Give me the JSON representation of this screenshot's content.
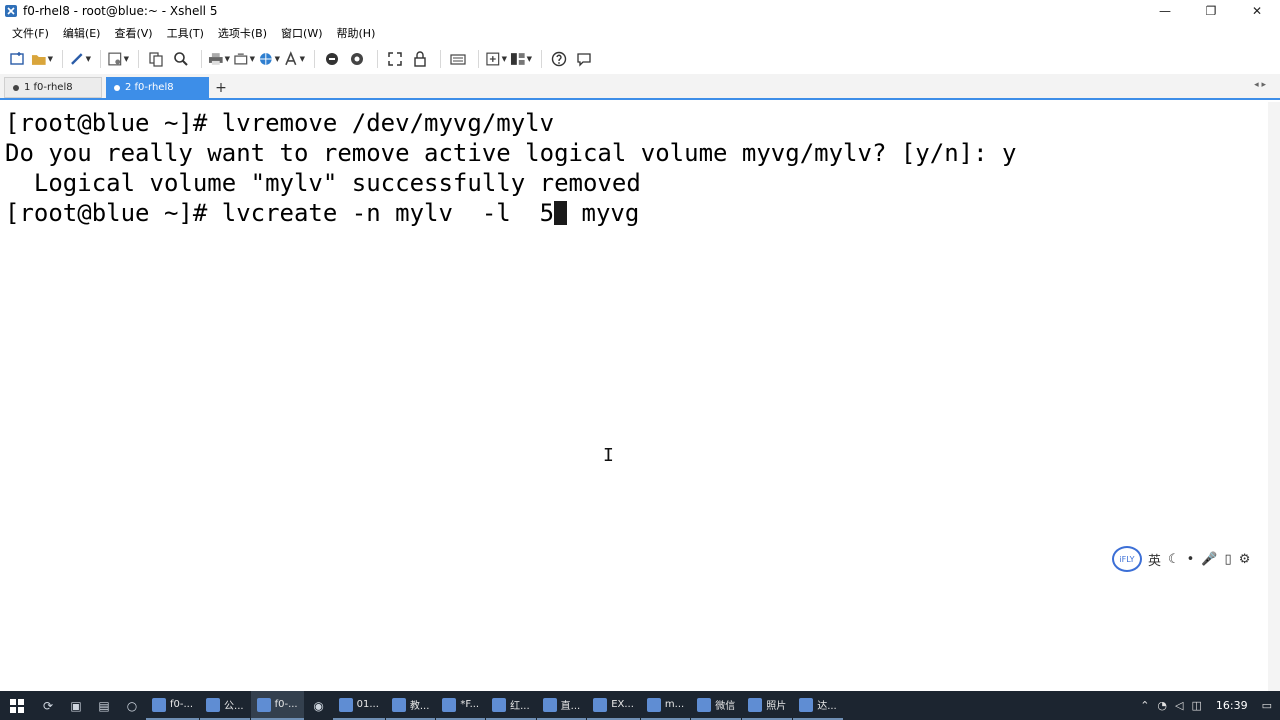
{
  "window": {
    "title": "f0-rhel8 - root@blue:~ - Xshell 5",
    "controls": {
      "minimize": "—",
      "restore": "❐",
      "close": "✕"
    }
  },
  "menu": [
    "文件(F)",
    "编辑(E)",
    "查看(V)",
    "工具(T)",
    "选项卡(B)",
    "窗口(W)",
    "帮助(H)"
  ],
  "tabs": [
    {
      "label": "1 f0-rhel8",
      "active": false
    },
    {
      "label": "2 f0-rhel8",
      "active": true
    }
  ],
  "tab_add": "+",
  "tab_menu": "◂ ▸",
  "terminal": {
    "lines": [
      "[root@blue ~]# lvremove /dev/myvg/mylv",
      "Do you really want to remove active logical volume myvg/mylv? [y/n]: y",
      "  Logical volume \"mylv\" successfully removed"
    ],
    "prompt_before_cursor": "[root@blue ~]# lvcreate -n mylv  -l  5",
    "prompt_after_cursor": " myvg",
    "mouse_cursor": "I"
  },
  "ime": {
    "logo": "iFLY",
    "items": [
      "英",
      "☾",
      "•",
      "🎤",
      "▯",
      "⚙"
    ]
  },
  "taskbar": {
    "apps": [
      {
        "label": "f0-...",
        "active": false
      },
      {
        "label": "公...",
        "active": false
      },
      {
        "label": "f0-...",
        "active": true
      },
      {
        "label": "01...",
        "active": false
      },
      {
        "label": "教...",
        "active": false
      },
      {
        "label": "*F...",
        "active": false
      },
      {
        "label": "红...",
        "active": false
      },
      {
        "label": "直...",
        "active": false
      },
      {
        "label": "EX...",
        "active": false
      },
      {
        "label": "m...",
        "active": false
      },
      {
        "label": "微信",
        "active": false
      },
      {
        "label": "照片",
        "active": false
      },
      {
        "label": "达...",
        "active": false
      }
    ],
    "clock": "16:39"
  },
  "colors": {
    "accent": "#3d8ee8",
    "taskbar": "#1c2530",
    "terminal_bg": "#ffffff",
    "terminal_fg": "#000000"
  }
}
